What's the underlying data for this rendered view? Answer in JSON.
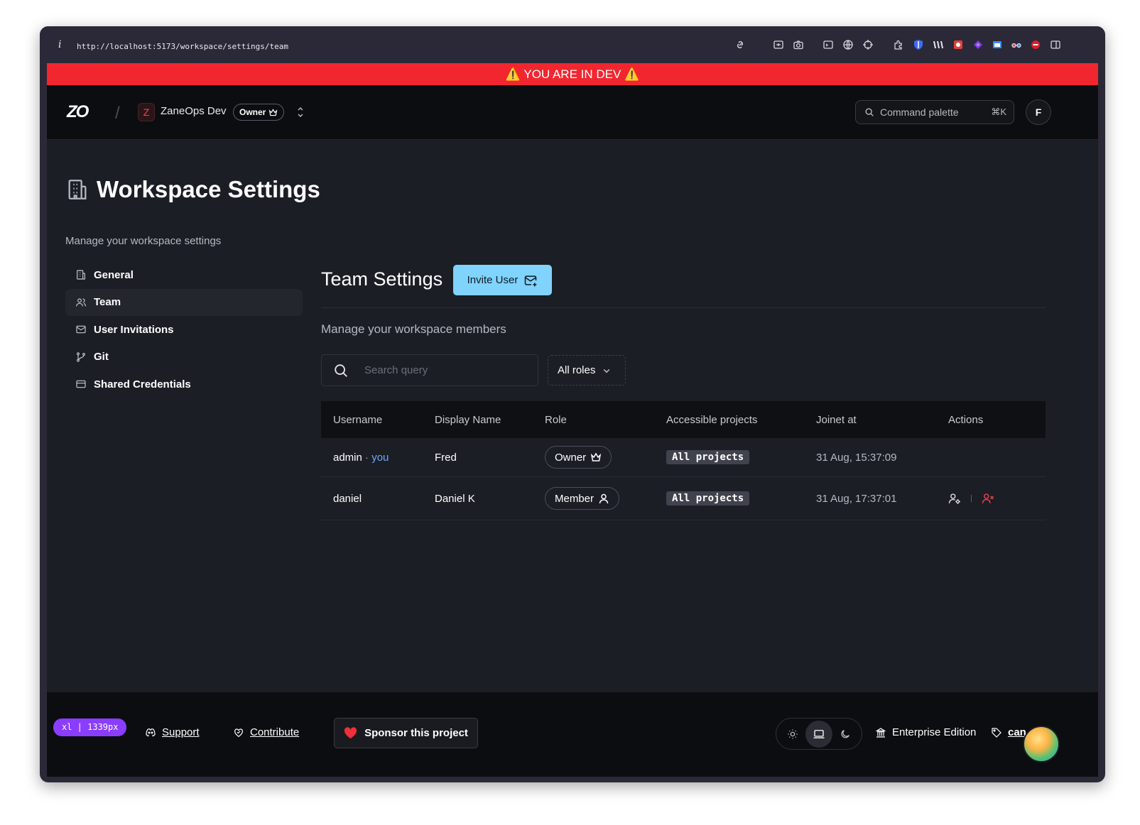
{
  "browser": {
    "url": "http://localhost:5173/workspace/settings/team",
    "info_icon": "i"
  },
  "dev_banner": "⚠️ YOU ARE IN DEV ⚠️",
  "topnav": {
    "logo": "ZO",
    "separator": "/",
    "workspace_initial": "Z",
    "workspace_name": "ZaneOps Dev",
    "workspace_role": "Owner",
    "command_palette_label": "Command palette",
    "command_palette_shortcut": "⌘K",
    "avatar_initial": "F"
  },
  "page": {
    "title": "Workspace Settings",
    "subtitle": "Manage your workspace settings"
  },
  "sidebar": {
    "items": [
      {
        "label": "General",
        "icon": "building-icon",
        "active": false
      },
      {
        "label": "Team",
        "icon": "users-icon",
        "active": true
      },
      {
        "label": "User Invitations",
        "icon": "mail-icon",
        "active": false
      },
      {
        "label": "Git",
        "icon": "git-branch-icon",
        "active": false
      },
      {
        "label": "Shared Credentials",
        "icon": "credit-card-icon",
        "active": false
      }
    ]
  },
  "team": {
    "title": "Team Settings",
    "invite_label": "Invite User",
    "description": "Manage your workspace members",
    "search_placeholder": "Search query",
    "roles_filter": "All roles",
    "columns": [
      "Username",
      "Display Name",
      "Role",
      "Accessible projects",
      "Joinet at",
      "Actions"
    ],
    "rows": [
      {
        "username": "admin",
        "separator": "·",
        "you": "you",
        "display_name": "Fred",
        "role": "Owner",
        "projects": "All projects",
        "joined": "31 Aug, 15:37:09"
      },
      {
        "username": "daniel",
        "display_name": "Daniel K",
        "role": "Member",
        "projects": "All projects",
        "joined": "31 Aug, 17:37:01"
      }
    ]
  },
  "footer": {
    "breakpoint": "xl | 1339px",
    "support": "Support",
    "contribute": "Contribute",
    "sponsor": "Sponsor this project",
    "edition": "Enterprise Edition",
    "canary": "can"
  },
  "colors": {
    "dev_banner": "#f2262f",
    "invite_button": "#7fd3fc",
    "accent_you": "#6aa9f7",
    "danger": "#f0484f",
    "breakpoint_badge": "#8b3dff"
  }
}
